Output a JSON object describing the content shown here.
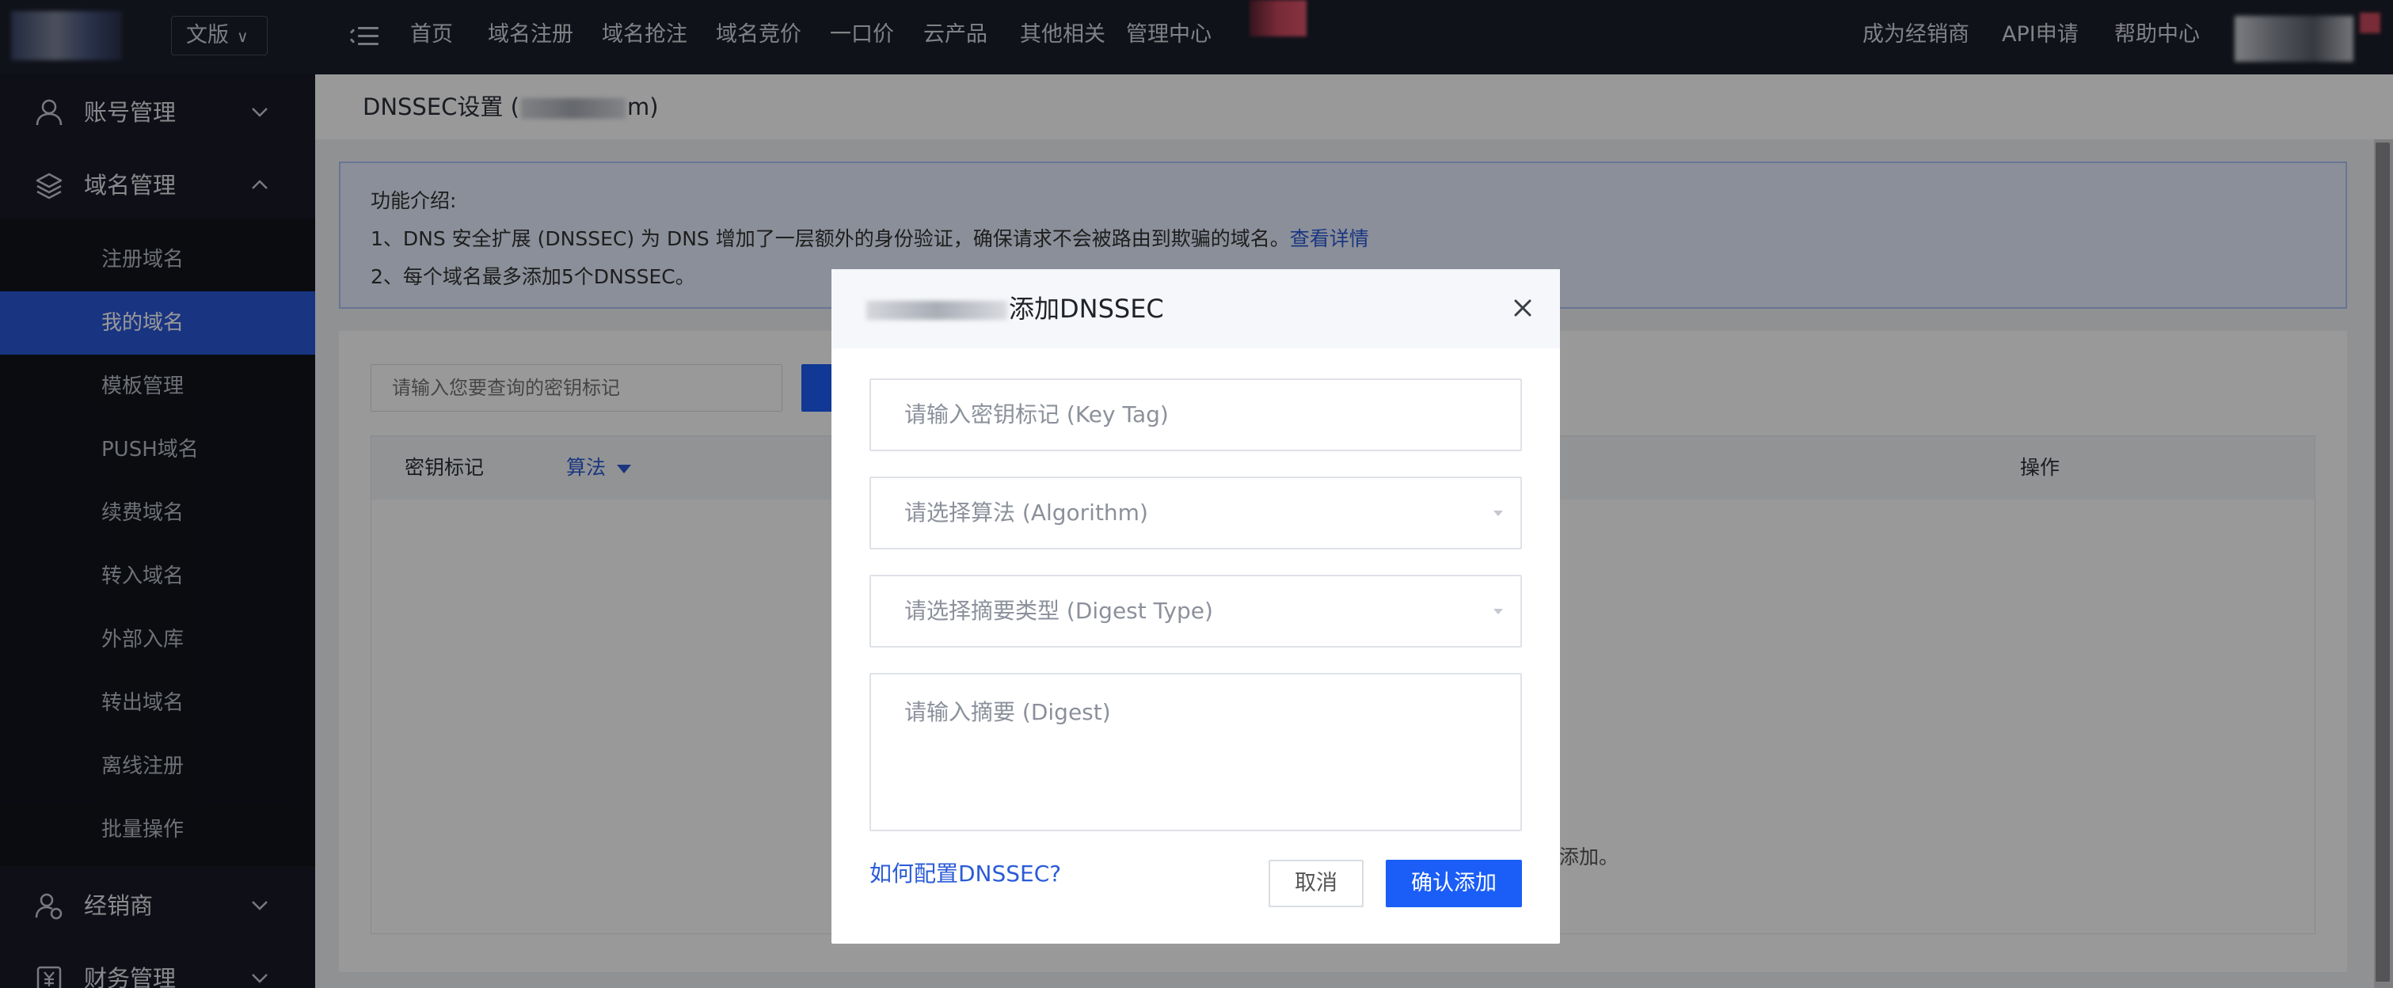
{
  "topbar": {
    "language_button": "文版",
    "nav": [
      "首页",
      "域名注册",
      "域名抢注",
      "域名竞价",
      "一口价",
      "云产品",
      "其他相关",
      "管理中心"
    ],
    "right_links": [
      "成为经销商",
      "API申请",
      "帮助中心"
    ]
  },
  "sidebar": {
    "groups": [
      {
        "label": "账号管理",
        "icon": "user-icon",
        "expanded": false
      },
      {
        "label": "域名管理",
        "icon": "layers-icon",
        "expanded": true
      },
      {
        "label": "经销商",
        "icon": "reseller-icon",
        "expanded": false
      },
      {
        "label": "财务管理",
        "icon": "finance-icon",
        "expanded": false
      }
    ],
    "sub_items": [
      "注册域名",
      "我的域名",
      "模板管理",
      "PUSH域名",
      "续费域名",
      "转入域名",
      "外部入库",
      "转出域名",
      "离线注册",
      "批量操作"
    ],
    "active_item": "我的域名",
    "accent_color": "#2b58d8"
  },
  "page": {
    "title_prefix": "DNSSEC设置 (",
    "title_suffix": "m)"
  },
  "info": {
    "heading": "功能介绍:",
    "line1": "1、DNS 安全扩展 (DNSSEC) 为 DNS 增加了一层额外的身份验证，确保请求不会被路由到欺骗的域名。",
    "line1_link": "查看详情",
    "line2": "2、每个域名最多添加5个DNSSEC。"
  },
  "list": {
    "search_placeholder": "请输入您要查询的密钥标记",
    "columns": [
      "密钥标记",
      "算法",
      "操作"
    ],
    "empty_text_fragment": "添加。"
  },
  "modal": {
    "title": "添加DNSSEC",
    "key_tag_placeholder": "请输入密钥标记 (Key Tag)",
    "algorithm_placeholder": "请选择算法 (Algorithm)",
    "digest_type_placeholder": "请选择摘要类型 (Digest Type)",
    "digest_placeholder": "请输入摘要 (Digest)",
    "help_link": "如何配置DNSSEC?",
    "cancel_label": "取消",
    "confirm_label": "确认添加",
    "primary_color": "#1b5ef7"
  }
}
